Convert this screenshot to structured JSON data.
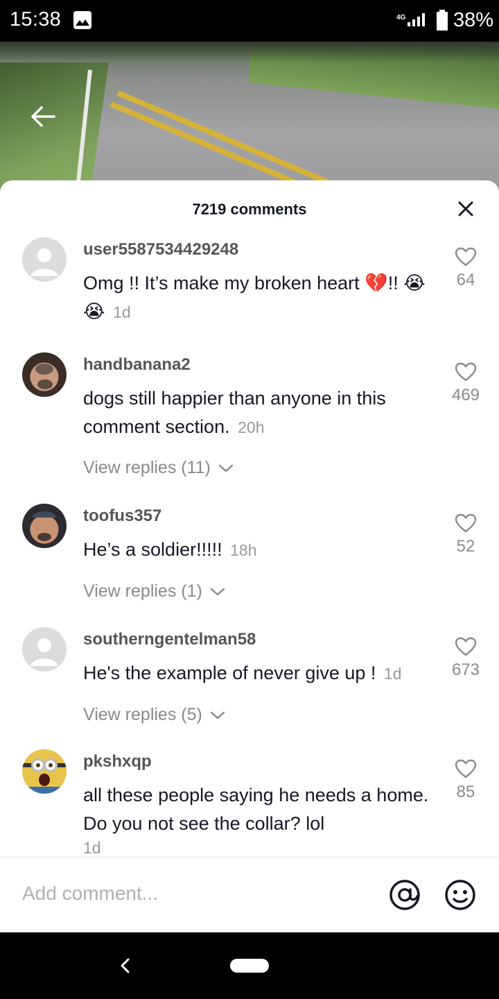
{
  "status_bar": {
    "time": "15:38",
    "network": "4G",
    "battery": "38%",
    "icons": [
      "image-icon",
      "signal-icon",
      "battery-icon"
    ]
  },
  "video": {
    "back_icon": "arrow-left-icon"
  },
  "comments_panel": {
    "title": "7219 comments",
    "close_icon": "close-icon",
    "comments": [
      {
        "username": "user5587534429248",
        "text": "Omg !! It’s make my broken heart 💔!! 😭😭",
        "time": "1d",
        "likes": "64",
        "avatar": "default-avatar"
      },
      {
        "username": "handbanana2",
        "text": "dogs still happier than anyone in this comment section.",
        "time": "20h",
        "likes": "469",
        "replies": "View replies (11)",
        "avatar": "photo-avatar"
      },
      {
        "username": "toofus357",
        "text": "He’s a soldier!!!!!",
        "time": "18h",
        "likes": "52",
        "replies": "View replies (1)",
        "avatar": "photo-avatar"
      },
      {
        "username": "southerngentelman58",
        "text": "He's the example of never give up !",
        "time": "1d",
        "likes": "673",
        "replies": "View replies (5)",
        "avatar": "default-avatar"
      },
      {
        "username": "pkshxqp",
        "text": "all these people saying he needs a home. Do you not see the collar? lol",
        "time": "1d",
        "likes": "85",
        "avatar": "minion-avatar"
      }
    ]
  },
  "input": {
    "placeholder": "Add comment...",
    "mention_icon": "at-icon",
    "emoji_icon": "emoji-icon"
  },
  "colors": {
    "text_primary": "#161823",
    "text_secondary": "#8a8a8a",
    "background": "#ffffff"
  }
}
